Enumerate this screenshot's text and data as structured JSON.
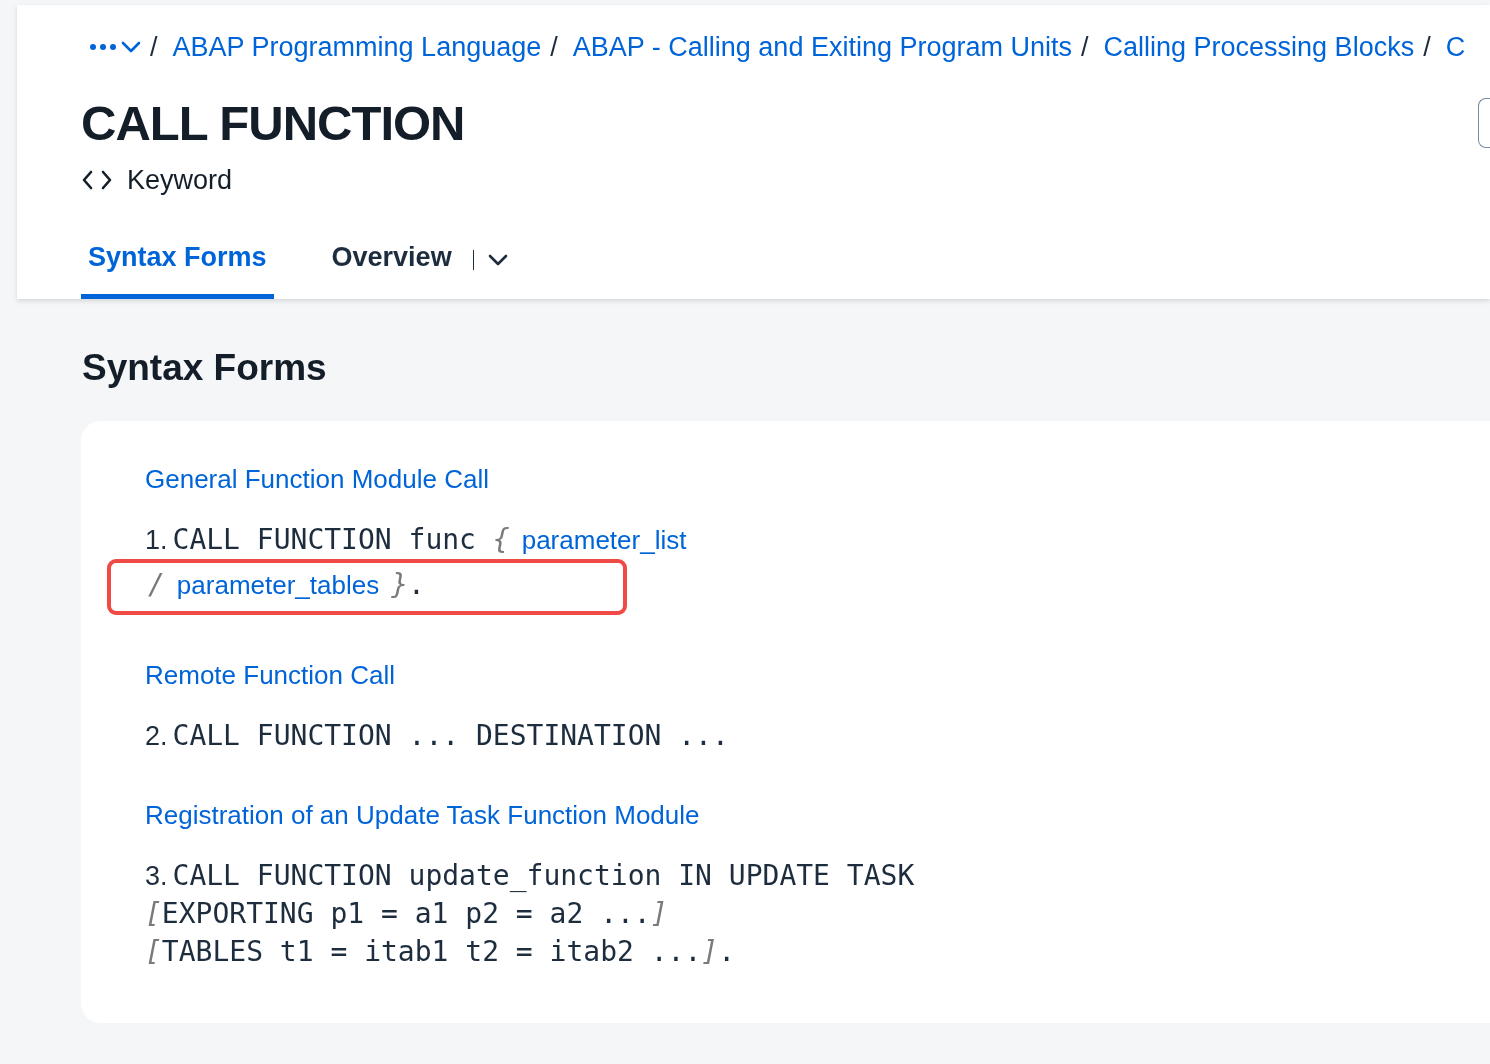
{
  "breadcrumb": {
    "items": [
      {
        "separator": "/",
        "label": "ABAP Programming Language"
      },
      {
        "separator": "/",
        "label": "ABAP - Calling and Exiting Program Units"
      },
      {
        "separator": "/",
        "label": "Calling Processing Blocks"
      },
      {
        "separator": "/",
        "label": "C"
      }
    ]
  },
  "page": {
    "title": "CALL FUNCTION",
    "type": "Keyword"
  },
  "tabs": [
    {
      "label": "Syntax Forms",
      "selected": true,
      "menu": false
    },
    {
      "label": "Overview",
      "selected": false,
      "menu": true
    }
  ],
  "section": {
    "heading": "Syntax Forms",
    "forms": [
      {
        "title": "General Function Module Call",
        "lines": [
          {
            "highlighted": false,
            "segments": [
              {
                "kind": "number",
                "text": "1."
              },
              {
                "kind": "code",
                "text": "CALL FUNCTION func "
              },
              {
                "kind": "bracket",
                "text": "{"
              },
              {
                "kind": "link",
                "text": "parameter_list"
              }
            ]
          },
          {
            "highlighted": true,
            "segments": [
              {
                "kind": "bracket",
                "text": "/"
              },
              {
                "kind": "link",
                "text": "parameter_tables"
              },
              {
                "kind": "bracket",
                "text": "}"
              },
              {
                "kind": "code",
                "text": "."
              }
            ]
          }
        ]
      },
      {
        "title": "Remote Function Call",
        "lines": [
          {
            "highlighted": false,
            "segments": [
              {
                "kind": "number",
                "text": "2."
              },
              {
                "kind": "code",
                "text": "CALL FUNCTION ... DESTINATION ..."
              }
            ]
          }
        ]
      },
      {
        "title": "Registration of an Update Task Function Module",
        "lines": [
          {
            "highlighted": false,
            "segments": [
              {
                "kind": "number",
                "text": "3."
              },
              {
                "kind": "code",
                "text": "CALL FUNCTION update_function IN UPDATE TASK"
              }
            ]
          },
          {
            "highlighted": false,
            "segments": [
              {
                "kind": "bracket",
                "text": "["
              },
              {
                "kind": "code",
                "text": "EXPORTING p1 = a1 p2 = a2 ..."
              },
              {
                "kind": "bracket",
                "text": "]"
              }
            ]
          },
          {
            "highlighted": false,
            "segments": [
              {
                "kind": "bracket",
                "text": "["
              },
              {
                "kind": "code",
                "text": "TABLES t1 = itab1 t2 = itab2 ..."
              },
              {
                "kind": "bracket",
                "text": "]"
              },
              {
                "kind": "code",
                "text": "."
              }
            ]
          }
        ]
      }
    ]
  }
}
